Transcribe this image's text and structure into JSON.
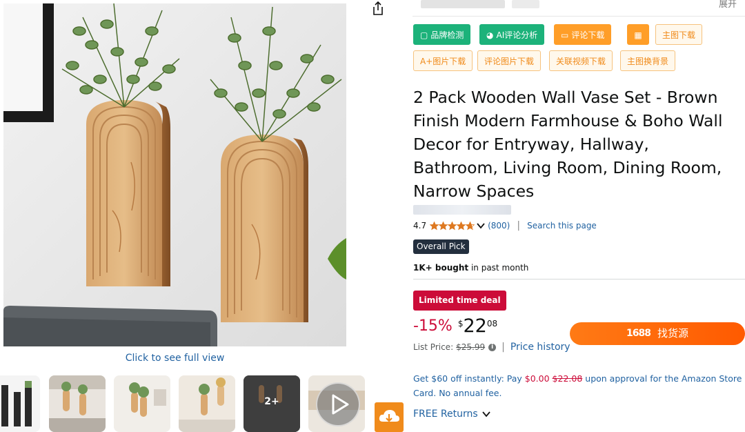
{
  "toolbar": {
    "expand_label": "展开",
    "buttons": [
      {
        "label": "品牌检测",
        "icon": "square-icon"
      },
      {
        "label": "AI评论分析",
        "icon": "pie-chart-icon"
      },
      {
        "label": "评论下载",
        "icon": "comment-icon"
      },
      {
        "label": "",
        "icon": "calculator-icon"
      },
      {
        "label": "主图下载",
        "icon": ""
      },
      {
        "label": "A+图片下载",
        "icon": ""
      },
      {
        "label": "评论图片下载",
        "icon": ""
      },
      {
        "label": "关联视频下载",
        "icon": ""
      },
      {
        "label": "主图换背景",
        "icon": ""
      }
    ]
  },
  "gallery": {
    "full_view_label": "Click to see full view",
    "more_label": "2+"
  },
  "product": {
    "title": "2 Pack Wooden Wall Vase Set - Brown Finish Modern Farmhouse & Boho Wall Decor for Entryway, Hallway, Bathroom, Living Room, Dining Room, Narrow Spaces",
    "rating": "4.7",
    "rating_value": 4.7,
    "review_count": "(800)",
    "search_page": "Search this page",
    "badge": "Overall Pick",
    "bought_bold": "1K+ bought",
    "bought_rest": " in past month",
    "deal_label": "Limited time deal",
    "discount": "-15%",
    "currency": "$",
    "price_whole": "22",
    "price_fraction": "08",
    "list_price_label": "List Price:",
    "list_price": "$25.99",
    "price_history": "Price history",
    "find_source_logo": "1688",
    "find_source_label": "找货源",
    "promo_a": "Get $60 off instantly: Pay ",
    "promo_pay": "$0.00",
    "promo_b": " ",
    "promo_old": "$22.08",
    "promo_c": " upon approval for the Amazon Store Card. No annual fee.",
    "free_returns": "FREE Returns"
  },
  "colors": {
    "link": "#2162a1",
    "deal_red": "#cc0c39",
    "star": "#de7921",
    "tool_green": "#1cb27a",
    "tool_orange": "#ff9e28",
    "source_orange": "#ff6a00"
  }
}
